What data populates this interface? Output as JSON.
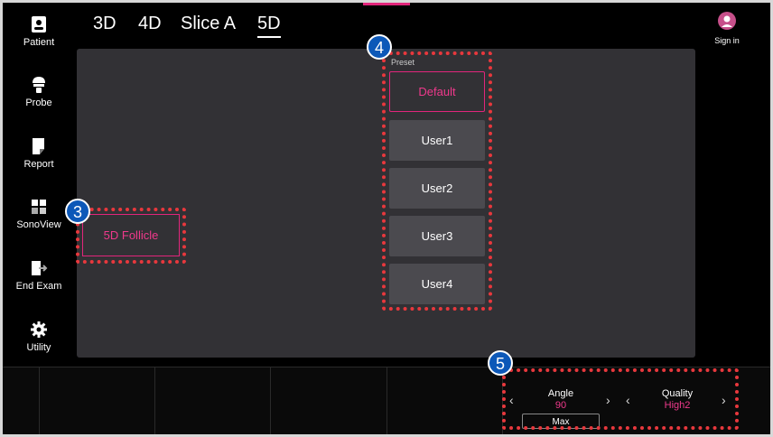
{
  "sidebar": {
    "items": [
      {
        "label": "Patient",
        "icon": "patient-icon"
      },
      {
        "label": "Probe",
        "icon": "probe-icon"
      },
      {
        "label": "Report",
        "icon": "report-icon"
      },
      {
        "label": "SonoView",
        "icon": "sonoview-icon"
      },
      {
        "label": "End Exam",
        "icon": "end-exam-icon"
      },
      {
        "label": "Utility",
        "icon": "gear-icon"
      }
    ]
  },
  "tabs": [
    {
      "label": "3D"
    },
    {
      "label": "4D"
    },
    {
      "label": "Slice A"
    },
    {
      "label": "5D",
      "active": true
    }
  ],
  "header": {
    "signin_label": "Sign in"
  },
  "preset": {
    "label": "Preset",
    "buttons": [
      "Default",
      "User1",
      "User2",
      "User3",
      "User4"
    ],
    "selected": "Default"
  },
  "follicle": {
    "label": "5D Follicle"
  },
  "badges": {
    "b3": "3",
    "b4": "4",
    "b5": "5"
  },
  "controls": {
    "angle": {
      "title": "Angle",
      "value": "90",
      "sub_button": "Max"
    },
    "quality": {
      "title": "Quality",
      "value": "High2"
    }
  },
  "colors": {
    "accent": "#e2257b",
    "annotation": "#e8383d",
    "badge": "#0c58b8",
    "panel": "#323135"
  }
}
